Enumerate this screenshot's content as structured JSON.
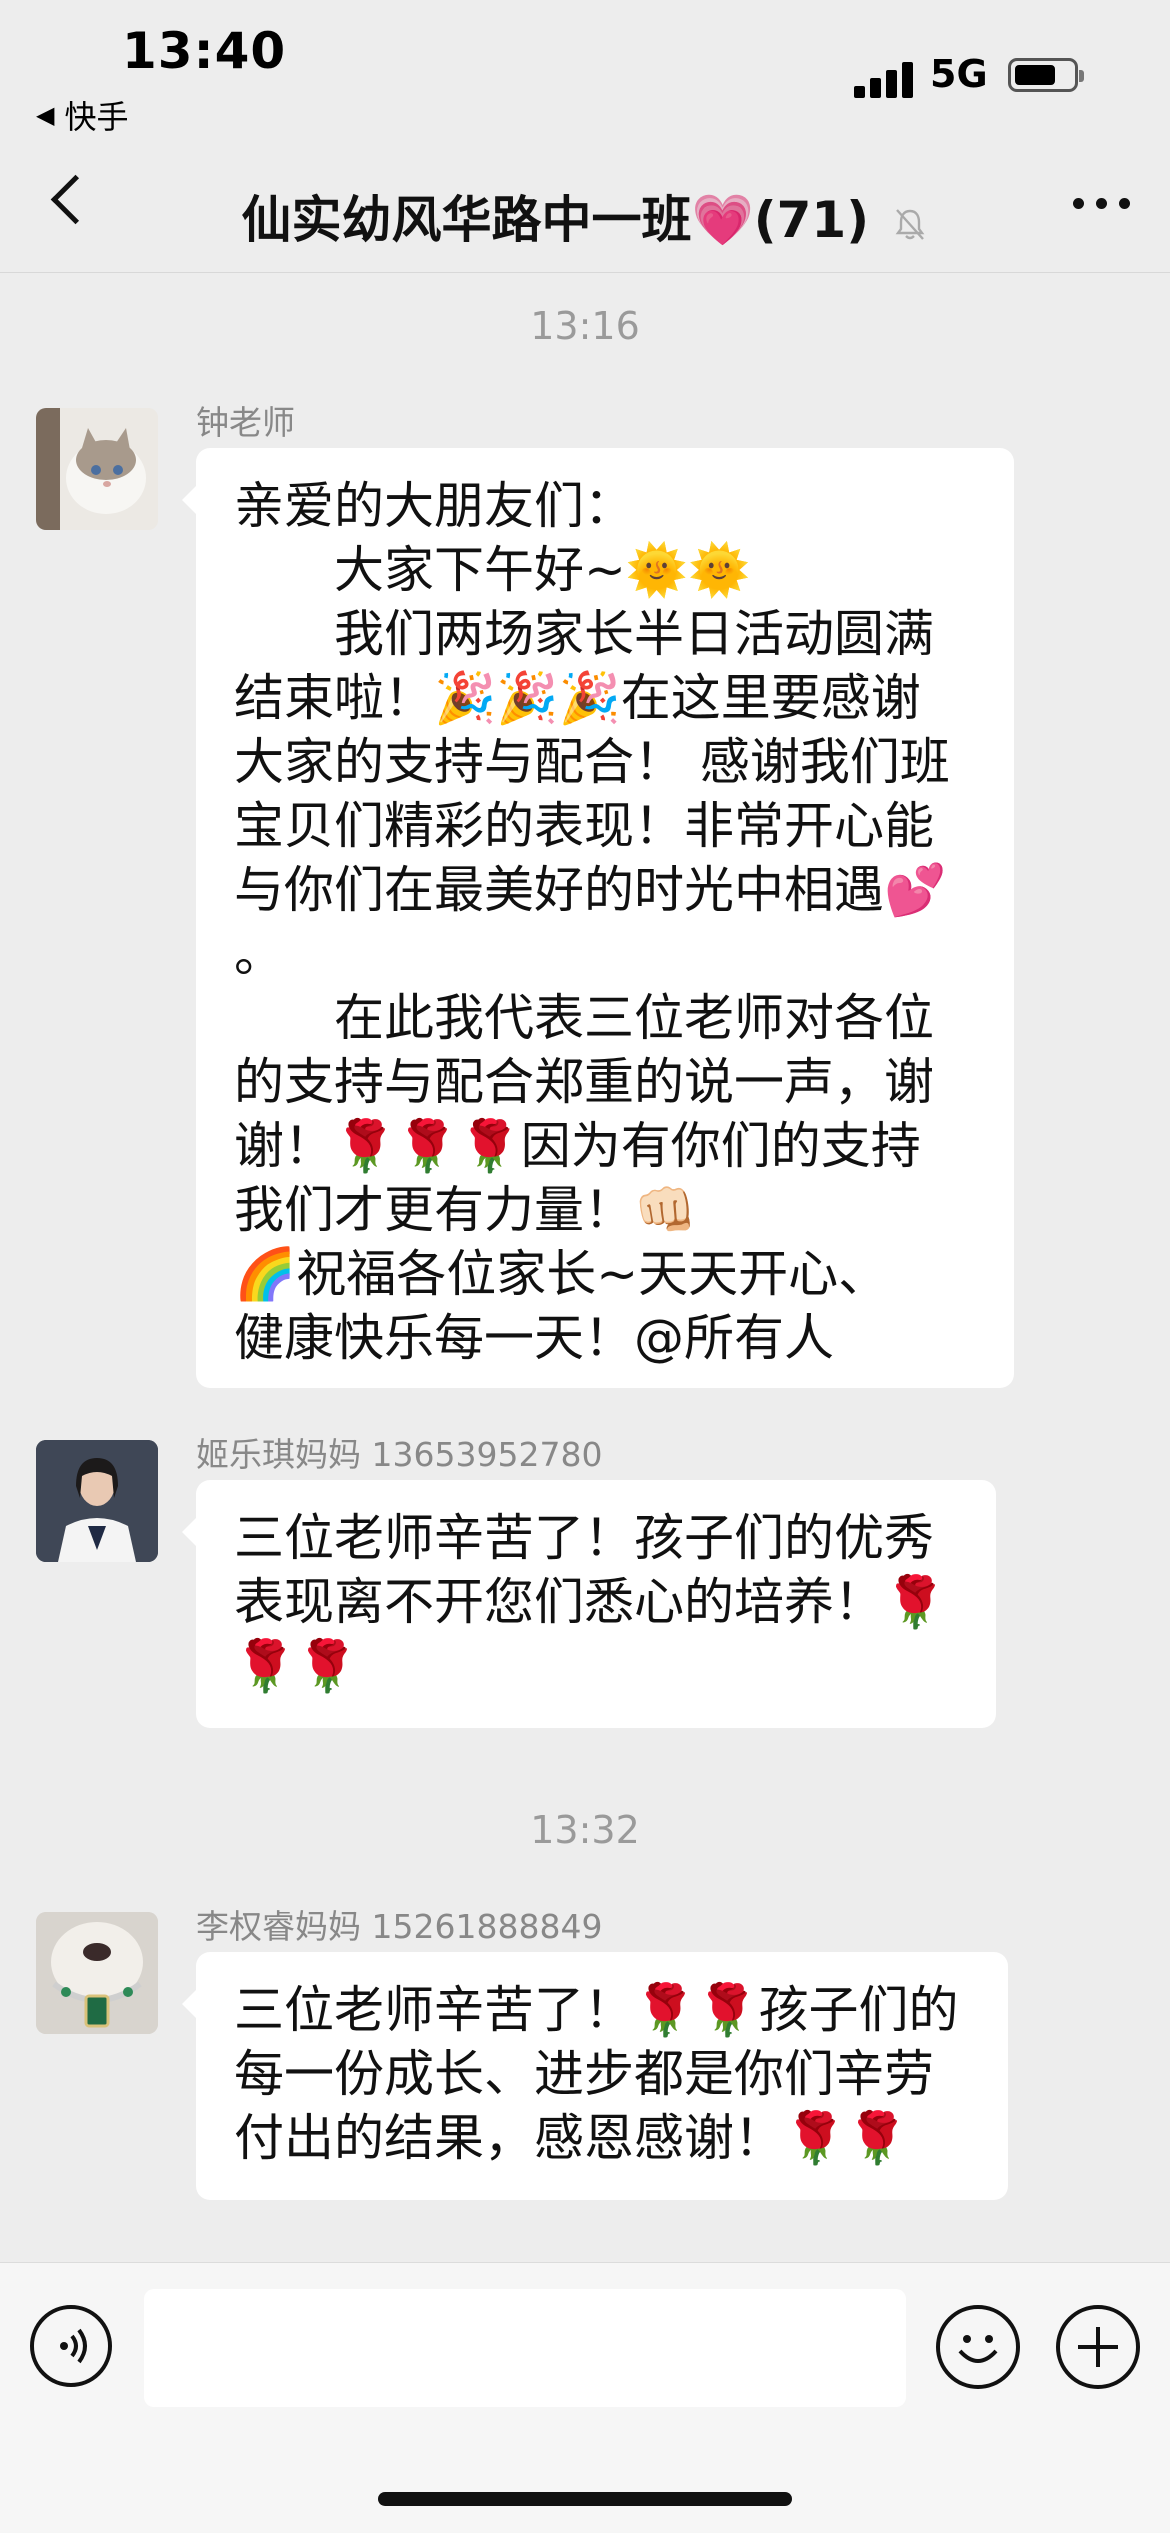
{
  "status_bar": {
    "time": "13:40",
    "back_app": "快手",
    "network": "5G",
    "battery_level": 0.72
  },
  "nav": {
    "title": "仙实幼风华路中一班💗(71)",
    "icons": [
      "back-icon",
      "mute-icon",
      "more-icon"
    ]
  },
  "chat": {
    "timestamps": [
      "13:16",
      "13:32"
    ],
    "messages": [
      {
        "sender": "钟老师",
        "lines": [
          "亲爱的大朋友们：",
          "　　大家下午好~🌞🌞",
          "　　我们两场家长半日活动圆满",
          "结束啦！🎉🎉🎉在这里要感谢",
          "大家的支持与配合！ 感谢我们班",
          "宝贝们精彩的表现！非常开心能",
          "与你们在最美好的时光中相遇💕",
          "。",
          "　　在此我代表三位老师对各位",
          "的支持与配合郑重的说一声，谢",
          "谢！🌹🌹🌹因为有你们的支持",
          "我们才更有力量！👊🏻",
          "🌈祝福各位家长~天天开心、",
          "健康快乐每一天！@所有人"
        ]
      },
      {
        "sender": "姬乐琪妈妈 13653952780",
        "lines": [
          "三位老师辛苦了！孩子们的优秀",
          "表现离不开您们悉心的培养！🌹",
          "🌹🌹"
        ]
      },
      {
        "sender": "李权睿妈妈 15261888849",
        "lines": [
          "三位老师辛苦了！🌹🌹孩子们的",
          "每一份成长、进步都是你们辛劳",
          "付出的结果，感恩感谢！🌹🌹"
        ]
      }
    ]
  },
  "input_bar": {
    "placeholder": "",
    "icons": [
      "voice-icon",
      "emoji-icon",
      "plus-icon"
    ]
  }
}
